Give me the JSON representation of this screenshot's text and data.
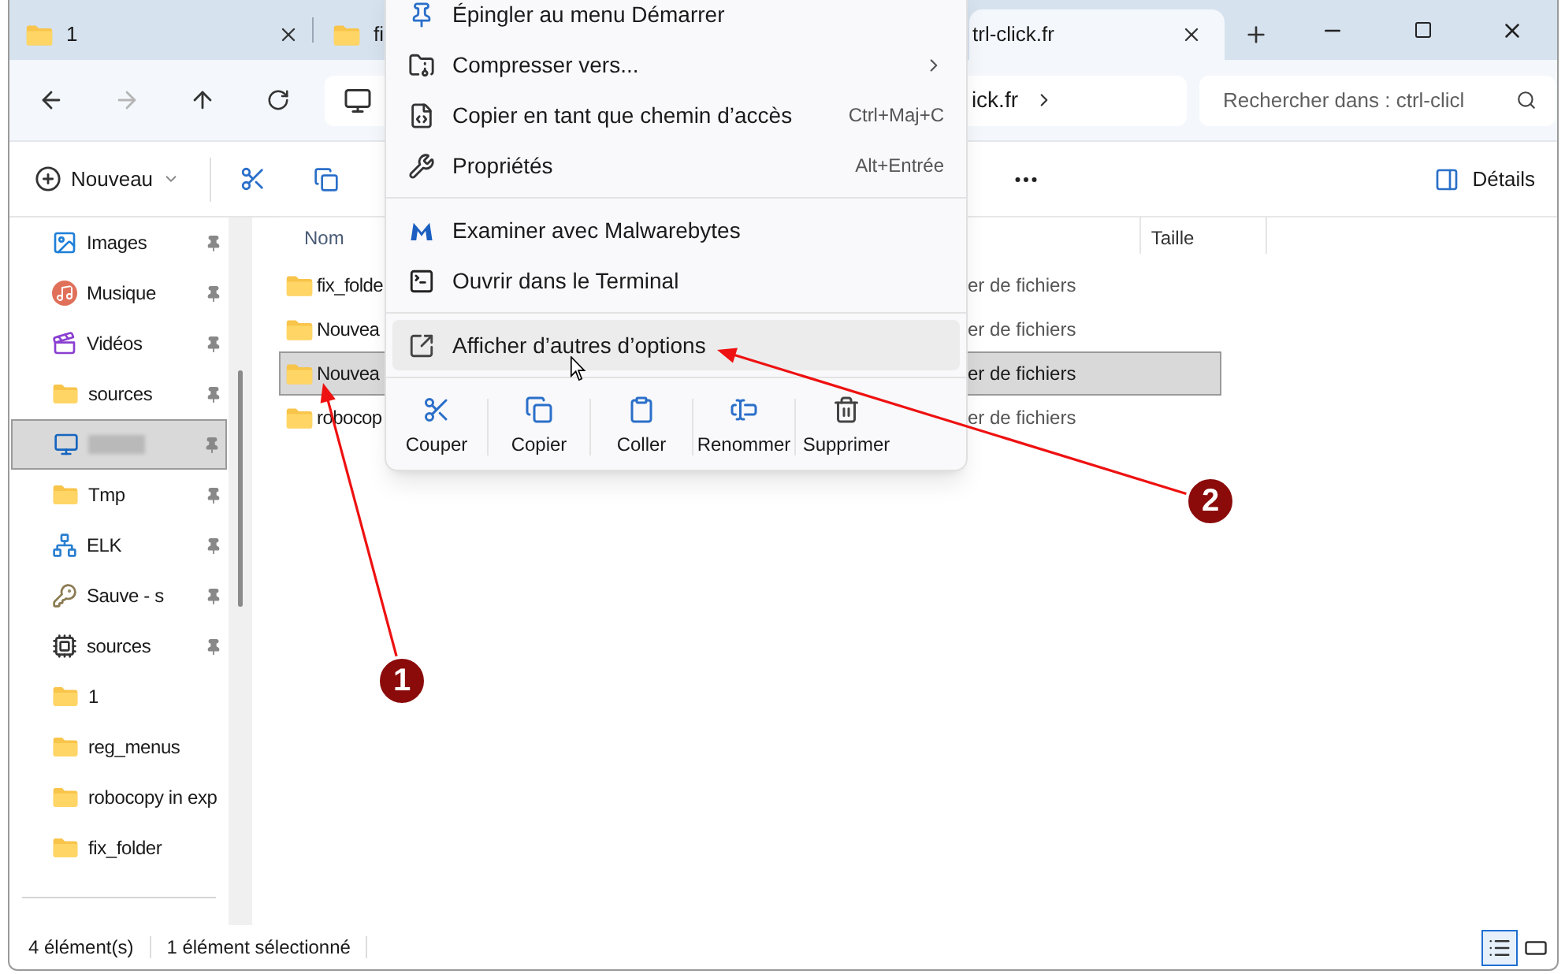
{
  "tabs": [
    {
      "title": "1",
      "selected": false,
      "close_button": true
    },
    {
      "title": "fi",
      "selected": false,
      "close_button": false
    },
    {
      "title": "trl-click.fr",
      "selected": true,
      "close_button": true
    }
  ],
  "address": {
    "path_text": "ick.fr"
  },
  "search": {
    "placeholder": "Rechercher dans : ctrl-clicl"
  },
  "toolbar": {
    "new_label": "Nouveau",
    "details_label": "Détails"
  },
  "sidebar": {
    "items": [
      {
        "kind": "images",
        "label": "Images",
        "pinned": true,
        "selected": false
      },
      {
        "kind": "music",
        "label": "Musique",
        "pinned": true,
        "selected": false
      },
      {
        "kind": "video",
        "label": "Vidéos",
        "pinned": true,
        "selected": false
      },
      {
        "kind": "folder",
        "label": "sources",
        "pinned": true,
        "selected": false
      },
      {
        "kind": "monitor",
        "pinned": true,
        "selected": true
      },
      {
        "kind": "folder",
        "label": "Tmp",
        "pinned": true,
        "selected": false
      },
      {
        "kind": "network",
        "label": "ELK",
        "pinned": true,
        "selected": false
      },
      {
        "kind": "key",
        "label": "Sauve - s",
        "pinned": true,
        "selected": false
      },
      {
        "kind": "chip",
        "label": "sources",
        "pinned": true,
        "selected": false
      },
      {
        "kind": "folder",
        "label": "1",
        "pinned": false,
        "selected": false
      },
      {
        "kind": "folder",
        "label": "reg_menus",
        "pinned": false,
        "selected": false
      },
      {
        "kind": "folder",
        "label": "robocopy in exp",
        "pinned": false,
        "selected": false
      },
      {
        "kind": "folder",
        "label": "fix_folder",
        "pinned": false,
        "selected": false
      }
    ]
  },
  "columns": {
    "name": "Nom",
    "size": "Taille"
  },
  "files": [
    {
      "name": "fix_folde",
      "type": "er de fichiers",
      "selected": false
    },
    {
      "name": "Nouvea",
      "type": "er de fichiers",
      "selected": false
    },
    {
      "name": "Nouvea",
      "type": "er de fichiers",
      "selected": true
    },
    {
      "name": "robocop",
      "type": "er de fichiers",
      "selected": false
    }
  ],
  "context_menu": {
    "items": [
      {
        "kind": "item",
        "label": "Épingler au menu Démarrer",
        "highlighted": false
      },
      {
        "kind": "item",
        "label": "Compresser vers...",
        "submenu": true,
        "highlighted": false
      },
      {
        "kind": "item",
        "label": "Copier en tant que chemin d’accès",
        "shortcut": "Ctrl+Maj+C",
        "highlighted": false
      },
      {
        "kind": "item",
        "label": "Propriétés",
        "shortcut": "Alt+Entrée",
        "highlighted": false
      },
      {
        "kind": "divider"
      },
      {
        "kind": "item",
        "label": "Examiner avec Malwarebytes",
        "highlighted": false
      },
      {
        "kind": "item",
        "label": "Ouvrir dans le Terminal",
        "highlighted": false
      },
      {
        "kind": "divider"
      },
      {
        "kind": "item",
        "label": "Afficher d’autres d’options",
        "highlighted": true
      },
      {
        "kind": "divider"
      }
    ],
    "actions": [
      {
        "label": "Couper"
      },
      {
        "label": "Copier"
      },
      {
        "label": "Coller"
      },
      {
        "label": "Renommer"
      },
      {
        "label": "Supprimer"
      }
    ]
  },
  "status_bar": {
    "count": "4 élément(s)",
    "selection": "1 élément sélectionné",
    "views": [
      {
        "kind": "details",
        "selected": true
      },
      {
        "kind": "tiles",
        "selected": false
      }
    ]
  },
  "annotations": [
    {
      "number": "1"
    },
    {
      "number": "2"
    }
  ]
}
